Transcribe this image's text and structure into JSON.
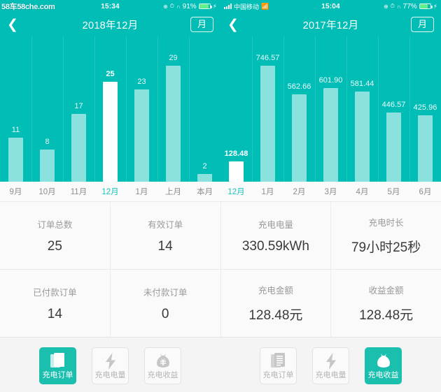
{
  "colors": {
    "teal": "#00bdb6",
    "bar": "#8ae1dd",
    "highlight_bar": "#ffffff",
    "accent": "#1bbfad",
    "panel_bg": "#fafafa",
    "text_dark": "#3a3a3a",
    "text_muted": "#9a9a9a"
  },
  "left_panel": {
    "watermark": {
      "part1": "58车",
      "part2": "58che.com"
    },
    "status_bar": {
      "carrier": "",
      "time": "15:34",
      "battery_text": "91%",
      "battery_level": 91,
      "icons": [
        "location-icon",
        "alarm-icon",
        "headphones-icon",
        "battery-icon",
        "charging-bolt-icon"
      ]
    },
    "nav": {
      "back_icon": "chevron-left-icon",
      "title": "2018年12月",
      "button_label": "月"
    },
    "chart_data": {
      "type": "bar",
      "title": "订单总数",
      "categories": [
        "9月",
        "10月",
        "11月",
        "12月",
        "1月",
        "上月",
        "本月"
      ],
      "values": [
        11,
        8,
        17,
        25,
        23,
        29,
        2
      ],
      "labels": [
        "11",
        "8",
        "17",
        "25",
        "23",
        "29",
        "2"
      ],
      "highlight_index": 3,
      "ylim": [
        0,
        29
      ],
      "xlabel": "",
      "ylabel": "",
      "grid": true,
      "legend": "none"
    }
  },
  "right_panel": {
    "status_bar": {
      "carrier": "中国移动",
      "time": "15:04",
      "battery_text": "77%",
      "battery_level": 77,
      "icons": [
        "signal-icon",
        "wifi-icon",
        "location-icon",
        "alarm-icon",
        "headphones-icon",
        "battery-icon",
        "charging-bolt-icon"
      ]
    },
    "nav": {
      "back_icon": "chevron-left-icon",
      "title": "2017年12月",
      "button_label": "月"
    },
    "chart_data": {
      "type": "bar",
      "title": "充电收益金额",
      "categories": [
        "12月",
        "1月",
        "2月",
        "3月",
        "4月",
        "5月",
        "6月"
      ],
      "values": [
        128.48,
        746.57,
        562.66,
        601.9,
        581.44,
        446.57,
        425.96
      ],
      "labels": [
        "128.48",
        "746.57",
        "562.66",
        "601.90",
        "581.44",
        "446.57",
        "425.96"
      ],
      "highlight_index": 0,
      "ylim": [
        0,
        746.57
      ],
      "xlabel": "",
      "ylabel": "",
      "grid": true,
      "legend": "none"
    }
  },
  "stats": {
    "row1": [
      {
        "label": "订单总数",
        "value": "25"
      },
      {
        "label": "有效订单",
        "value": "14"
      },
      {
        "label": "充电电量",
        "value": "330.59kWh"
      },
      {
        "label": "充电时长",
        "value": "79小时25秒"
      }
    ],
    "row2": [
      {
        "label": "已付款订单",
        "value": "14"
      },
      {
        "label": "未付款订单",
        "value": "0"
      },
      {
        "label": "充电金额",
        "value": "128.48元"
      },
      {
        "label": "收益金额",
        "value": "128.48元"
      }
    ]
  },
  "tabbars": {
    "left": {
      "tabs": [
        {
          "label": "充电订单",
          "icon": "document-icon",
          "active": true
        },
        {
          "label": "充电电量",
          "icon": "bolt-icon",
          "active": false
        },
        {
          "label": "充电收益",
          "icon": "money-bag-icon",
          "active": false
        }
      ]
    },
    "right": {
      "tabs": [
        {
          "label": "充电订单",
          "icon": "document-icon",
          "active": false
        },
        {
          "label": "充电电量",
          "icon": "bolt-icon",
          "active": false
        },
        {
          "label": "充电收益",
          "icon": "money-bag-icon",
          "active": true
        }
      ]
    }
  }
}
